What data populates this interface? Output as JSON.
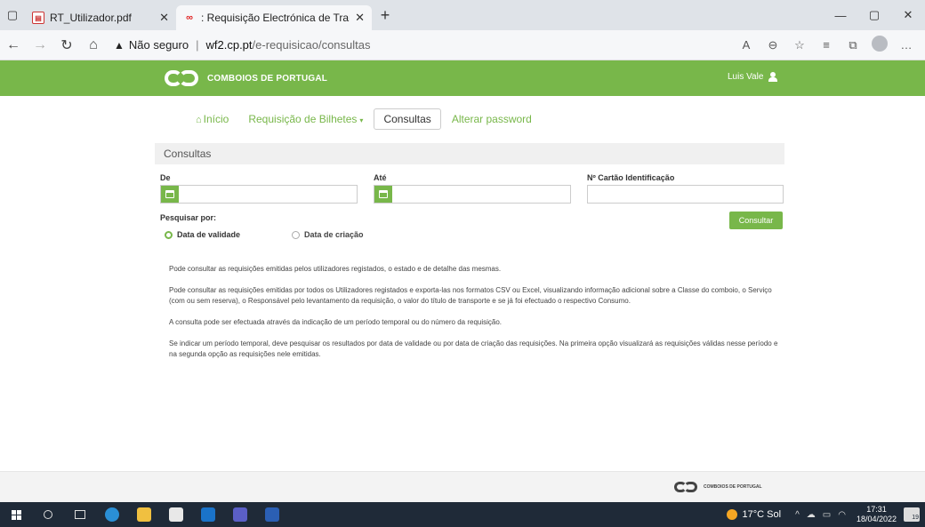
{
  "browser": {
    "tabs": [
      {
        "title": "RT_Utilizador.pdf",
        "icon": "pdf-icon"
      },
      {
        "title": ": Requisição Electrónica de Trans",
        "icon": "cp-logo-icon"
      }
    ],
    "security_label": "Não seguro",
    "url_host": "wf2.cp.pt",
    "url_path": "/e-requisicao/consultas"
  },
  "header": {
    "brand": "COMBOIOS DE PORTUGAL",
    "user_name": "Luis Vale"
  },
  "nav": {
    "items": [
      {
        "label": "Início"
      },
      {
        "label": "Requisição de Bilhetes"
      },
      {
        "label": "Consultas"
      },
      {
        "label": "Alterar password"
      }
    ],
    "active": "Consultas"
  },
  "consultas": {
    "title": "Consultas",
    "from_label": "De",
    "to_label": "Até",
    "id_card_label": "Nº Cartão Identificação",
    "search_by_label": "Pesquisar por:",
    "radio_validity": "Data de validade",
    "radio_creation": "Data de criação",
    "selected_radio": "Data de validade",
    "submit_label": "Consultar"
  },
  "info": [
    "Pode consultar as requisições emitidas pelos utilizadores registados, o estado e de detalhe das mesmas.",
    "Pode consultar as requisições emitidas por todos os Utilizadores registados e exporta-las nos formatos CSV ou Excel, visualizando informação adicional sobre a Classe do comboio, o Serviço (com ou sem reserva), o Responsável pelo levantamento da requisição, o valor do título de transporte e se já foi efectuado o respectivo Consumo.",
    "A consulta pode ser efectuada através da indicação de um período temporal ou do número da requisição.",
    "Se indicar um período temporal, deve pesquisar os resultados por data de validade ou por data de criação das requisições. Na primeira opção visualizará as requisições válidas nesse período e na segunda opção as requisições nele emitidas."
  ],
  "footer": {
    "brand": "COMBOIOS DE PORTUGAL"
  },
  "taskbar": {
    "weather": "17°C Sol",
    "time": "17:31",
    "date": "18/04/2022",
    "notifications": "19"
  },
  "colors": {
    "brand_green": "#78b74a",
    "taskbar_bg": "#1f2a38"
  }
}
